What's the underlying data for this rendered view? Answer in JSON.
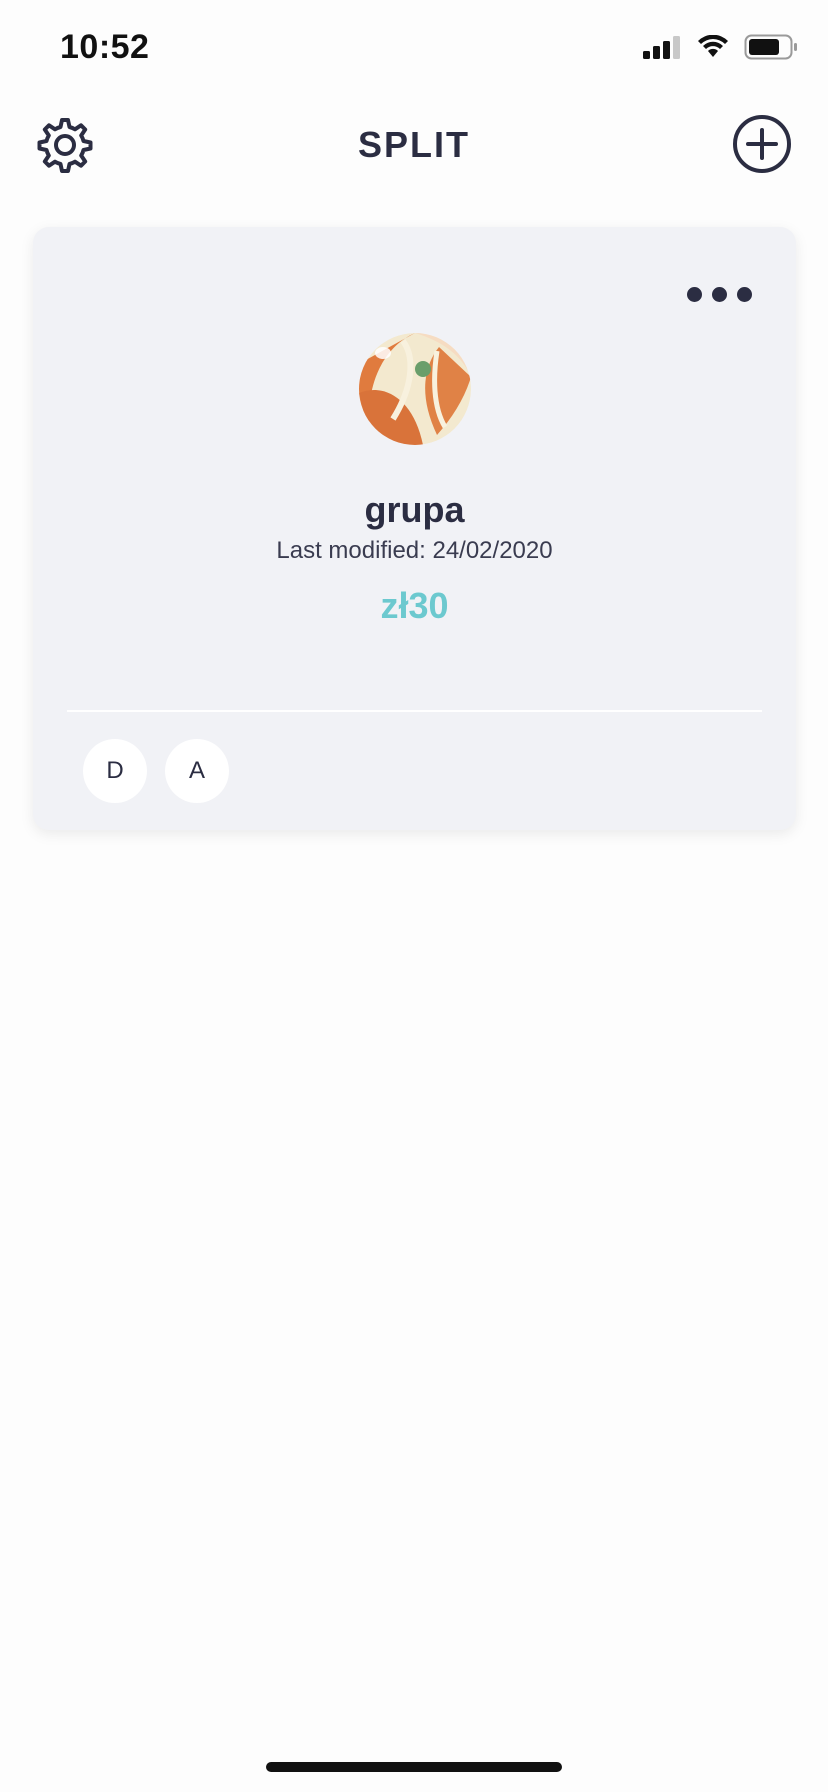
{
  "status_bar": {
    "time": "10:52"
  },
  "header": {
    "title": "SPLIT"
  },
  "group_card": {
    "name": "grupa",
    "last_modified": "Last modified: 24/02/2020",
    "amount": "zł30",
    "members": [
      "D",
      "A"
    ]
  },
  "colors": {
    "accent": "#6cc9cf",
    "card_bg": "#f1f2f6",
    "text_dark": "#2b2d42"
  },
  "icons": {
    "settings": "gear-icon",
    "add": "plus-circle-icon",
    "more": "more-dots-icon",
    "group": "beach-ball-icon"
  }
}
